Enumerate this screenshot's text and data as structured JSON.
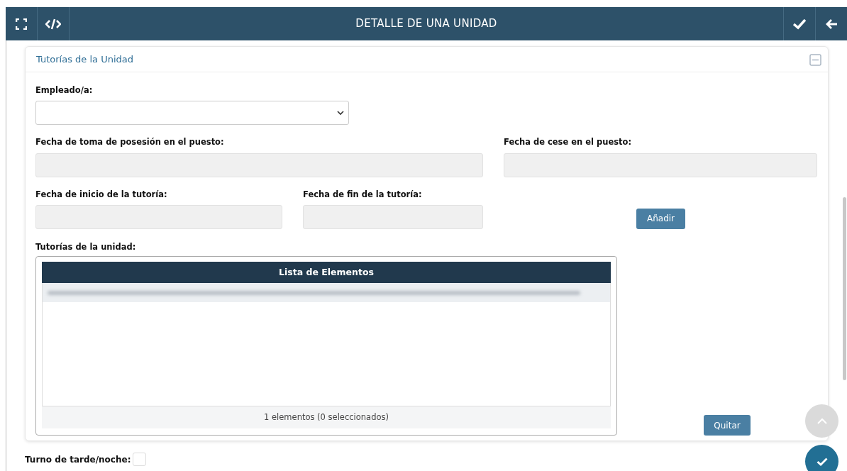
{
  "toolbar": {
    "title": "DETALLE DE UNA UNIDAD"
  },
  "panel": {
    "title": "Tutorías de la Unidad",
    "expanded": true
  },
  "fields": [
    {
      "label": "Empleado/a:",
      "kind": "select",
      "disabled": false
    },
    {
      "label": "Fecha de toma de posesión en el puesto:",
      "kind": "text",
      "disabled": true
    },
    {
      "label": "Fecha de cese en el puesto:",
      "kind": "text",
      "disabled": true
    },
    {
      "label": "Fecha de inicio de la tutoría:",
      "kind": "text",
      "disabled": true
    },
    {
      "label": "Fecha de fin de la tutoría:",
      "kind": "text",
      "disabled": true
    }
  ],
  "add_button": "Añadir",
  "list": {
    "label": "Tutorías de la unidad:",
    "header": "Lista de Elementos",
    "rows": [
      {
        "kind": "redacted"
      }
    ],
    "footer": "1 elementos (0 seleccionados)"
  },
  "remove_button": "Quitar",
  "night_shift": {
    "label": "Turno de tarde/noche:",
    "checked": false
  }
}
